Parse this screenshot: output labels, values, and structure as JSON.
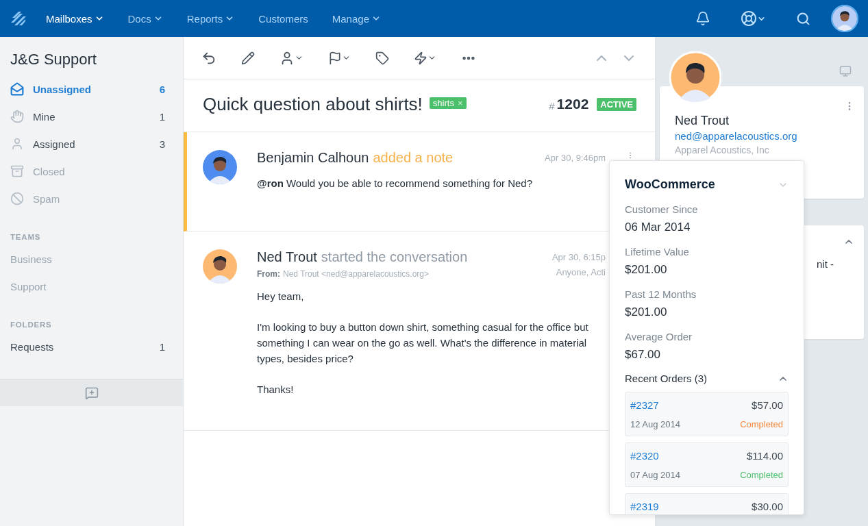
{
  "nav": {
    "items": [
      {
        "label": "Mailboxes",
        "selected": true,
        "dropdown": true
      },
      {
        "label": "Docs",
        "selected": false,
        "dropdown": true
      },
      {
        "label": "Reports",
        "selected": false,
        "dropdown": true
      },
      {
        "label": "Customers",
        "selected": false,
        "dropdown": false
      },
      {
        "label": "Manage",
        "selected": false,
        "dropdown": true
      }
    ]
  },
  "sidebar": {
    "title": "J&G Support",
    "folders": [
      {
        "kind": "envelope",
        "label": "Unassigned",
        "count": "6",
        "selected": true,
        "muted": false
      },
      {
        "kind": "hand",
        "label": "Mine",
        "count": "1",
        "selected": false,
        "muted": false
      },
      {
        "kind": "person",
        "label": "Assigned",
        "count": "3",
        "selected": false,
        "muted": false
      },
      {
        "kind": "archive",
        "label": "Closed",
        "selected": false,
        "muted": true
      },
      {
        "kind": "ban",
        "label": "Spam",
        "selected": false,
        "muted": true
      }
    ],
    "sections": [
      {
        "heading": "TEAMS",
        "items": [
          {
            "label": "Business",
            "muted": true
          },
          {
            "label": "Support",
            "muted": true
          }
        ]
      },
      {
        "heading": "FOLDERS",
        "items": [
          {
            "label": "Requests",
            "count": "1",
            "muted": false
          }
        ]
      }
    ]
  },
  "conversation": {
    "subject": "Quick question about shirts!",
    "tag": "shirts",
    "tag_remove": "×",
    "number_prefix": "#",
    "number": "1202",
    "status": "ACTIVE"
  },
  "threads": [
    {
      "kind": "note",
      "author": "Benjamin Calhoun",
      "action": "added a note",
      "time": "Apr 30, 9:46pm",
      "body": [
        "**@ron** Would you be able to recommend something for Ned?"
      ]
    },
    {
      "kind": "message",
      "author": "Ned Trout",
      "action": "started the conversation",
      "time": "Apr 30, 6:15p",
      "meta": "Anyone, Acti",
      "from_label": "From:",
      "from": "Ned Trout <ned@apparelacoustics.org>",
      "body": [
        "Hey team,",
        "I'm looking to buy a button down shirt, something casual for the office but something I can wear on the go as well. What's the difference in material types, besides price?",
        "Thanks!"
      ]
    }
  ],
  "customer": {
    "name": "Ned Trout",
    "email": "ned@apparelacoustics.org",
    "company": "Apparel Acoustics, Inc"
  },
  "second_card": {
    "text": "nit -"
  },
  "woocommerce": {
    "title": "WooCommerce",
    "fields": [
      {
        "label": "Customer Since",
        "value": "06 Mar 2014"
      },
      {
        "label": "Lifetime Value",
        "value": "$201.00"
      },
      {
        "label": "Past 12 Months",
        "value": "$201.00"
      },
      {
        "label": "Average Order",
        "value": "$67.00"
      }
    ],
    "orders_title": "Recent Orders (3)",
    "orders": [
      {
        "number": "#2327",
        "total": "$57.00",
        "date": "12 Aug 2014",
        "status": "Completed",
        "color": "#f5883b"
      },
      {
        "number": "#2320",
        "total": "$114.00",
        "date": "07 Aug 2014",
        "status": "Completed",
        "color": "#4bbf6b"
      },
      {
        "number": "#2319",
        "total": "$30.00"
      }
    ]
  }
}
